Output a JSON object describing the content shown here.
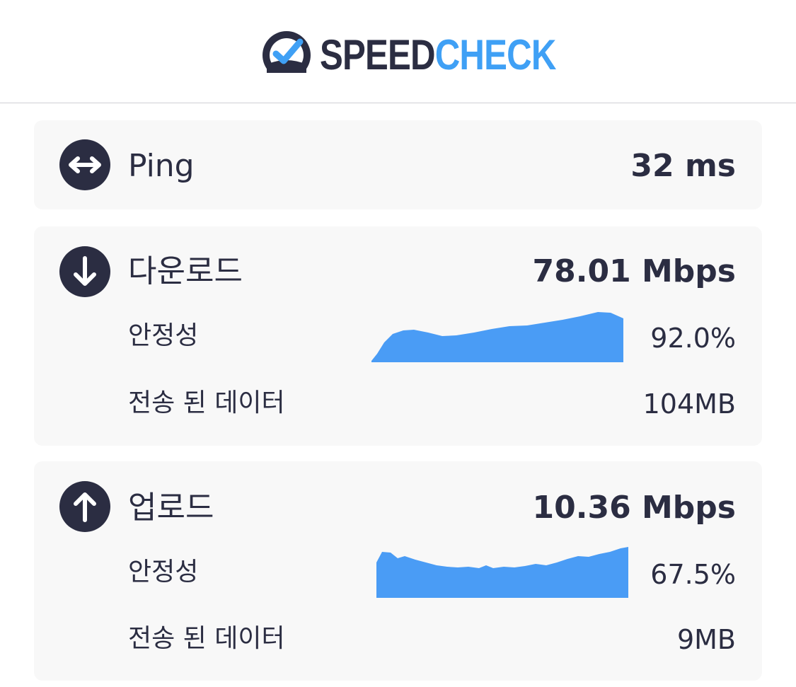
{
  "header": {
    "brand_part1": "SPEED",
    "brand_part2": "CHECK",
    "brand_color_dark": "#2b2d42",
    "brand_color_accent": "#3fa0f5"
  },
  "ping": {
    "icon": "double-arrow-icon",
    "label": "Ping",
    "value": "32 ms"
  },
  "download": {
    "icon": "arrow-down-icon",
    "label": "다운로드",
    "value": "78.01 Mbps",
    "stability_label": "안정성",
    "stability_value": "92.0%",
    "data_label": "전송 된 데이터",
    "data_value": "104MB",
    "sparkline_color": "#4a9cf5"
  },
  "upload": {
    "icon": "arrow-up-icon",
    "label": "업로드",
    "value": "10.36 Mbps",
    "stability_label": "안정성",
    "stability_value": "67.5%",
    "data_label": "전송 된 데이터",
    "data_value": "9MB",
    "sparkline_color": "#4a9cf5"
  }
}
